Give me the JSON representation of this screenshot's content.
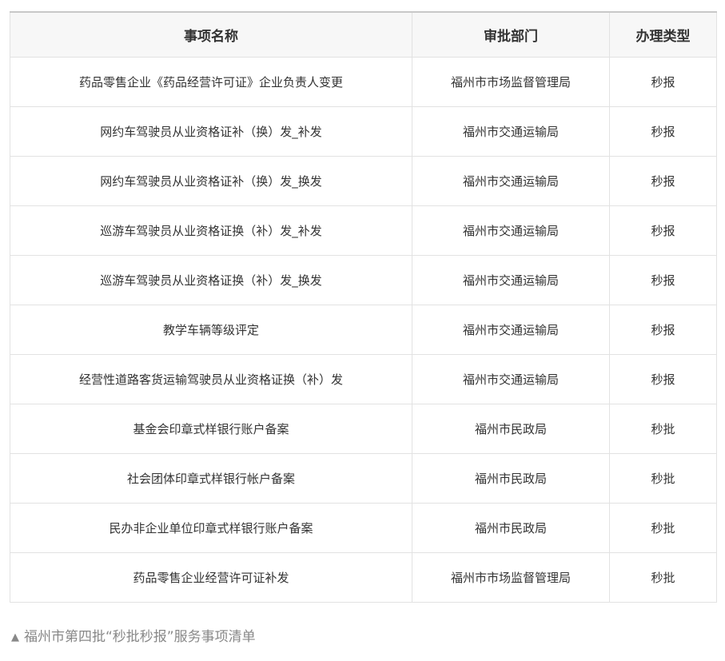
{
  "table": {
    "headers": [
      "事项名称",
      "审批部门",
      "办理类型"
    ],
    "rows": [
      [
        "药品零售企业《药品经营许可证》企业负责人变更",
        "福州市市场监督管理局",
        "秒报"
      ],
      [
        "网约车驾驶员从业资格证补（换）发_补发",
        "福州市交通运输局",
        "秒报"
      ],
      [
        "网约车驾驶员从业资格证补（换）发_换发",
        "福州市交通运输局",
        "秒报"
      ],
      [
        "巡游车驾驶员从业资格证换（补）发_补发",
        "福州市交通运输局",
        "秒报"
      ],
      [
        "巡游车驾驶员从业资格证换（补）发_换发",
        "福州市交通运输局",
        "秒报"
      ],
      [
        "教学车辆等级评定",
        "福州市交通运输局",
        "秒报"
      ],
      [
        "经营性道路客货运输驾驶员从业资格证换（补）发",
        "福州市交通运输局",
        "秒报"
      ],
      [
        "基金会印章式样银行账户备案",
        "福州市民政局",
        "秒批"
      ],
      [
        "社会团体印章式样银行帐户备案",
        "福州市民政局",
        "秒批"
      ],
      [
        "民办非企业单位印章式样银行账户备案",
        "福州市民政局",
        "秒批"
      ],
      [
        "药品零售企业经营许可证补发",
        "福州市市场监督管理局",
        "秒批"
      ]
    ]
  },
  "caption": {
    "icon": "triangle-up-icon",
    "text": "福州市第四批“秒批秒报”服务事项清单"
  },
  "colors": {
    "border": "#e2e2e2",
    "header_bg": "#f7f7f7",
    "text": "#333333",
    "caption": "#888888"
  }
}
